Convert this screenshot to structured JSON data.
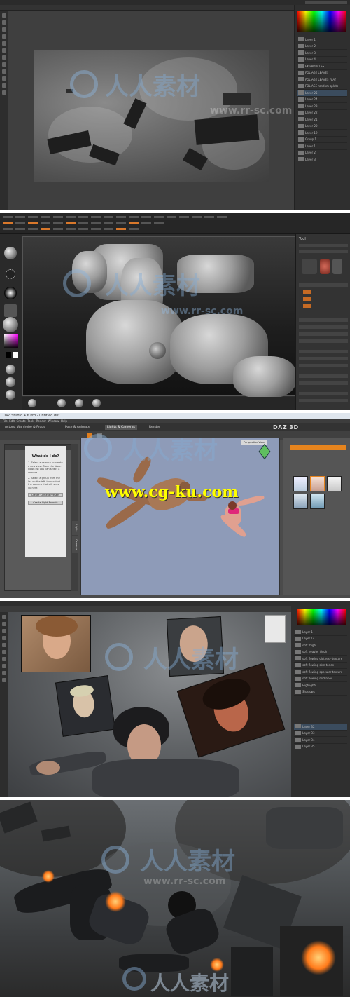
{
  "watermark": {
    "brand_text": "人人素材",
    "url_text": "www.cg-ku.com",
    "faint_url": "www.rr-sc.com"
  },
  "panel_photoshop_matte": {
    "layers": [
      "Layer 1",
      "Layer 2",
      "Layer 3",
      "Layer 4",
      "FX PARTICLES",
      "FOLIAGE LEAVES",
      "FOLIAGE LEAVES FLAT",
      "FOLIAGE random splats",
      "Layer 25",
      "Layer 24",
      "Layer 23",
      "Layer 22",
      "Layer 21",
      "Layer 20",
      "Layer 19",
      "Group 1",
      "Layer 1",
      "Layer 2",
      "Layer 3"
    ]
  },
  "panel_zbrush": {
    "right_title": "Tool",
    "menu": [
      "Alpha",
      "Brush",
      "Color",
      "Document",
      "Draw",
      "Edit",
      "File",
      "Layer",
      "Light",
      "Macro",
      "Marker",
      "Material",
      "Movie",
      "Picker",
      "Preferences",
      "Render",
      "Stencil",
      "Stroke",
      "Texture",
      "Tool",
      "Transform",
      "Zplugin",
      "Zscript"
    ]
  },
  "panel_daz": {
    "window_title": "DAZ Studio 4.6 Pro - untitled.duf",
    "menu": [
      "File",
      "Edit",
      "Create",
      "Tools",
      "Render",
      "Window",
      "Help"
    ],
    "tabs": [
      "Actors, Wardrobe & Props",
      "Pose & Animate",
      "Lights & Cameras",
      "Render"
    ],
    "active_tab": "Lights & Cameras",
    "logo": "DAZ 3D",
    "help_title": "What do I do?",
    "help_step1": "1. Select a camera to create a new view. From the drop-down list you can select a camera.",
    "help_step2": "2. Select a group from the list on the left, then select the camera that will show up here.",
    "btn_1": "Create Camera Presets",
    "btn_2": "Create Light Presets",
    "viewport_label": "Perspective View",
    "side_tabs": [
      "Lights",
      "Cameras"
    ],
    "right_side_tabs": [
      "Content Library",
      "Parameters",
      "Tool Settings"
    ]
  },
  "panel_photobash": {
    "layers": [
      "Layer 1",
      "Layer 14",
      "soft thigh",
      "soft heavier thigh",
      "soft flowing clothes - texture",
      "soft flowing skin tones",
      "soft flowing specular texture",
      "soft flowing midtones",
      "Highlights",
      "Shadows",
      "Layer 32",
      "Layer 33",
      "Layer 34",
      "Layer 35"
    ]
  },
  "colors": {
    "accent_orange": "#e6841e",
    "zbrush_orange": "#d9782b",
    "daz_viewport": "#8e9bb8",
    "ps_panel": "#2f2f2f"
  }
}
